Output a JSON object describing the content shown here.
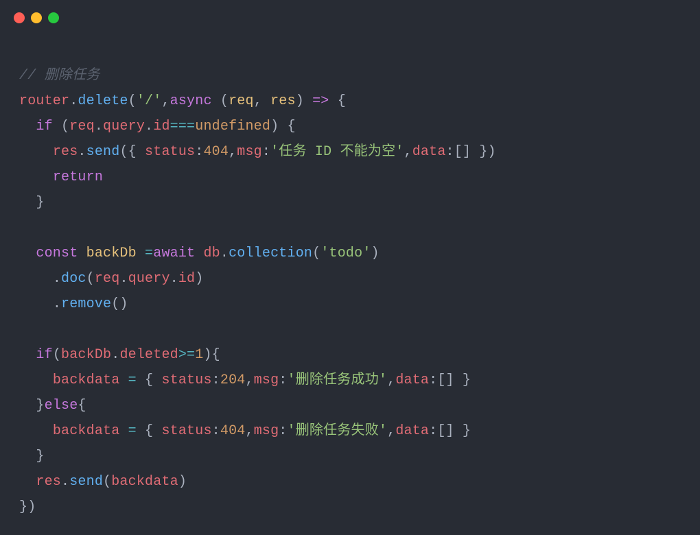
{
  "window": {
    "dots": [
      "close",
      "minimize",
      "zoom"
    ]
  },
  "code": {
    "comment": "// 删除任务",
    "router": "router",
    "delete": "delete",
    "route": "'/'",
    "async": "async",
    "req": "req",
    "res": "res",
    "arrow": "=>",
    "if": "if",
    "query": "query",
    "id": "id",
    "tripleeq": "===",
    "undefined": "undefined",
    "send": "send",
    "status": "status",
    "c404": "404",
    "msg": "msg",
    "emptyIdMsg": "'任务 ID 不能为空'",
    "data": "data",
    "return": "return",
    "const": "const",
    "backDb": "backDb",
    "eq": "=",
    "await": "await",
    "db": "db",
    "collection": "collection",
    "todo": "'todo'",
    "doc": "doc",
    "remove": "remove",
    "deleted": "deleted",
    "gte": ">=",
    "one": "1",
    "backdata": "backdata",
    "c204": "204",
    "successMsg": "'删除任务成功'",
    "else": "else",
    "failMsg": "'删除任务失败'"
  }
}
